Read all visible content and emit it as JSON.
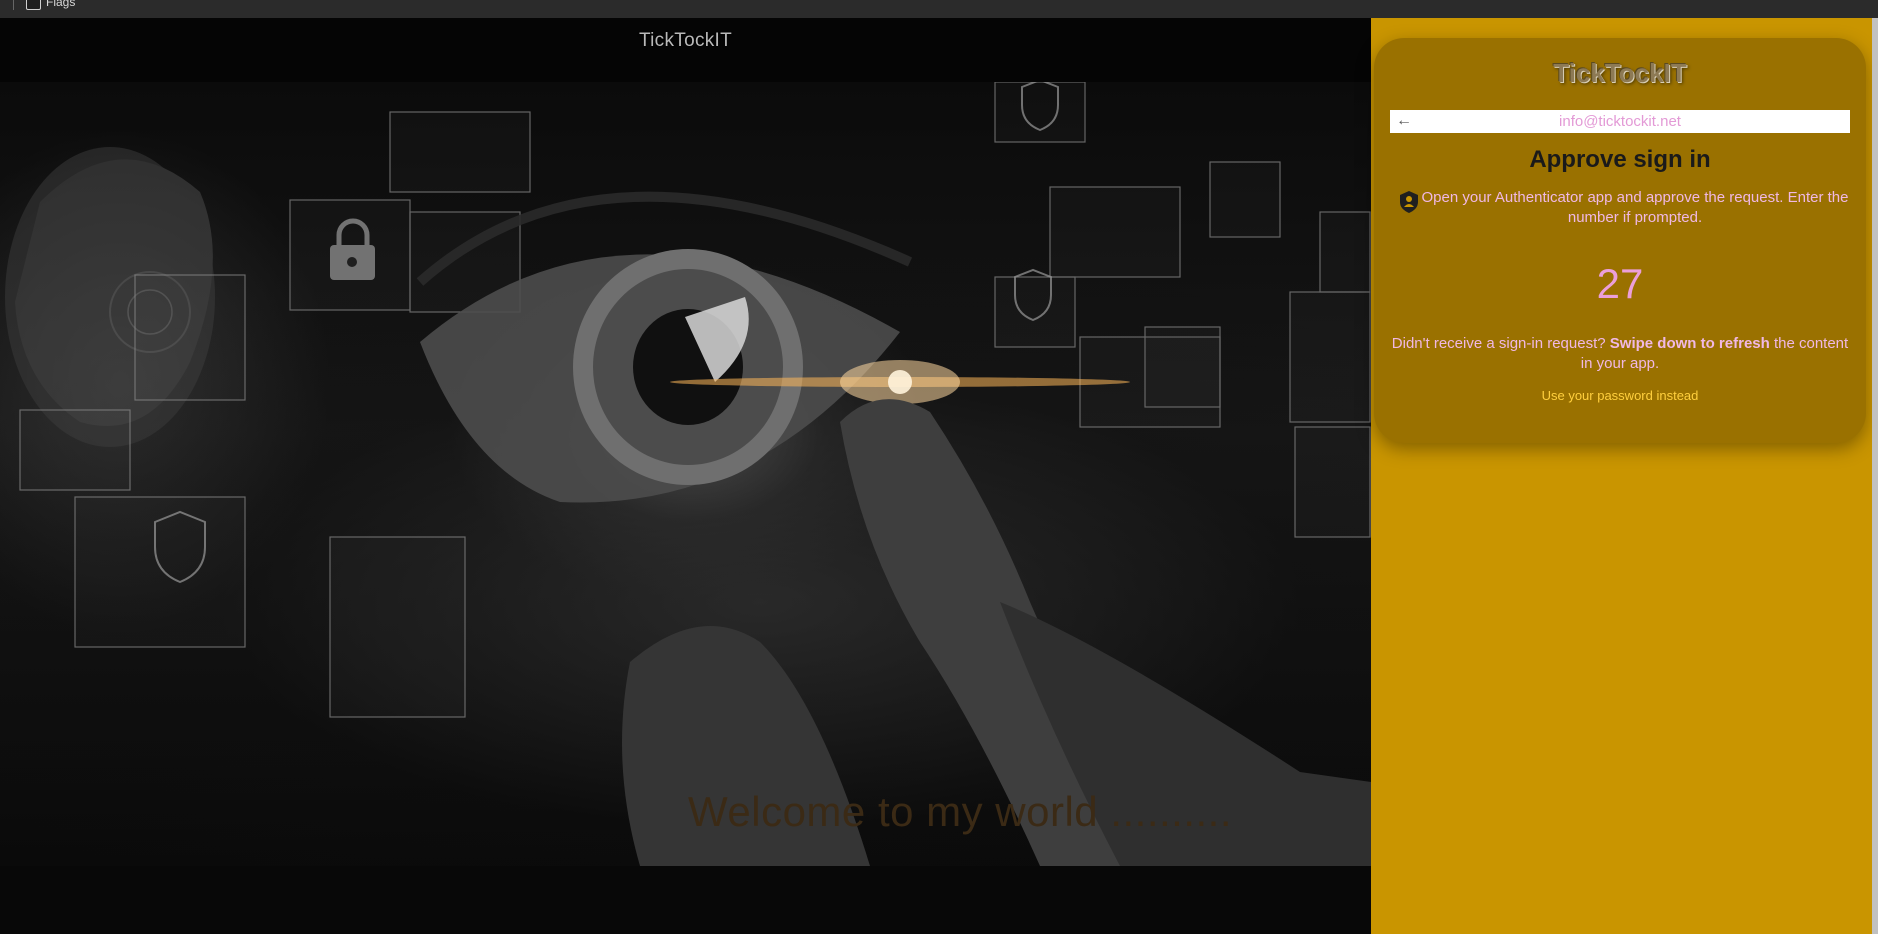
{
  "browser": {
    "flags_label": "Flags"
  },
  "hero": {
    "title": "TickTockIT",
    "welcome_text": "Welcome to my world ..........",
    "image_description_icon": "cyber-eye-image"
  },
  "signin": {
    "logo": "TickTockIT",
    "back_icon": "arrow-left-icon",
    "email": "info@ticktockit.net",
    "heading": "Approve sign in",
    "auth_icon": "authenticator-lock-icon",
    "instruction": "Open your Authenticator app and approve the request. Enter the number if prompted.",
    "number": "27",
    "no_request_prefix": "Didn't receive a sign-in request? ",
    "no_request_bold": "Swipe down to refresh",
    "no_request_suffix": " the content in your app.",
    "password_link": "Use your password instead"
  },
  "colors": {
    "panel": "#c99500",
    "card": "#9a7100",
    "pink_text": "#f0b8e4",
    "link": "#ffcf3d"
  }
}
